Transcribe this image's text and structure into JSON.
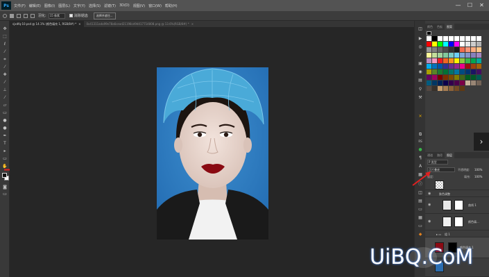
{
  "app": {
    "logo": "Ps"
  },
  "menu": [
    "文件(F)",
    "编辑(E)",
    "图像(I)",
    "图层(L)",
    "文字(Y)",
    "选择(S)",
    "滤镜(T)",
    "3D(D)",
    "视图(V)",
    "窗口(W)",
    "帮助(H)"
  ],
  "window_controls": {
    "minimize": "—",
    "maximize": "☐",
    "close": "✕"
  },
  "options": {
    "tolerance_label": "羽化:",
    "tolerance_value": "15 像素",
    "antialias_label": "消除锯齿",
    "select_button": "选择并遮住..."
  },
  "tabs": [
    {
      "label": "sjxdfq-10.psd @ 14.1% (颜色填充 1, RGB/8#) *",
      "close": "×",
      "active": true
    },
    {
      "label": "0x41311ada99e78a6cead21198cd9d417714808.png @ 13.6%(RGB/8#) *",
      "close": "×",
      "active": false
    }
  ],
  "panels": {
    "swatch_tabs": [
      "颜色",
      "色板",
      "图案"
    ],
    "layer_tabs": [
      "通道",
      "路径",
      "图层"
    ],
    "layer_filter": "P 类型",
    "blend_mode": "正片叠底",
    "opacity_label": "不透明度:",
    "opacity_value": "100%",
    "fill_label": "填充:",
    "fill_value": "100%",
    "lock_label": "锁定:",
    "layers": [
      {
        "name": ""
      },
      {
        "name": "肤色调整"
      },
      {
        "name": "曲线 1"
      },
      {
        "name": "颜色填..."
      },
      {
        "name": "组 1"
      },
      {
        "name": "颜色填充 1"
      },
      {
        "name": ""
      }
    ]
  },
  "watermark": "UiBQ.CoM",
  "colors": {
    "swatches": [
      "#ffffff",
      "#000000",
      "#ffffff",
      "#ffffff",
      "#ffffff",
      "#ffffff",
      "#ffffff",
      "#ffffff",
      "#ffffff",
      "#ffffff",
      "#ff0000",
      "#ffff00",
      "#00ff00",
      "#00ffff",
      "#0000ff",
      "#ff00ff",
      "#ffffff",
      "#e6e6e6",
      "#cccccc",
      "#b3b3b3",
      "#999999",
      "#808080",
      "#666666",
      "#4d4d4d",
      "#333333",
      "#1a1a1a",
      "#f26c4f",
      "#f69679",
      "#f9ad81",
      "#fdc689",
      "#fff799",
      "#c4df9b",
      "#a3d39c",
      "#82ca9c",
      "#7accc8",
      "#6dcff6",
      "#7da7d9",
      "#8393ca",
      "#8781bd",
      "#a187be",
      "#bd8cbf",
      "#f49ac2",
      "#ed1c24",
      "#f26522",
      "#f7941d",
      "#fff200",
      "#8dc63f",
      "#39b54a",
      "#00a651",
      "#00a99d",
      "#00aeef",
      "#0072bc",
      "#0054a6",
      "#2e3192",
      "#662d91",
      "#92278f",
      "#ec008c",
      "#9e0b0f",
      "#a0410d",
      "#a36209",
      "#aba000",
      "#598527",
      "#1a7b30",
      "#007236",
      "#00746b",
      "#0076a3",
      "#004b80",
      "#003471",
      "#1b1464",
      "#440e62",
      "#630460",
      "#9e005d",
      "#790000",
      "#7b2e00",
      "#7d4900",
      "#827b00",
      "#406618",
      "#005e20",
      "#005826",
      "#005952",
      "#005b7f",
      "#003663",
      "#002157",
      "#0d004c",
      "#32004b",
      "#4b0049",
      "#7b0046",
      "#c7b299",
      "#998675",
      "#736357",
      "#534741",
      "#37302a",
      "#c69c6d",
      "#a67c52",
      "#8c6239",
      "#754c24",
      "#603913"
    ]
  }
}
